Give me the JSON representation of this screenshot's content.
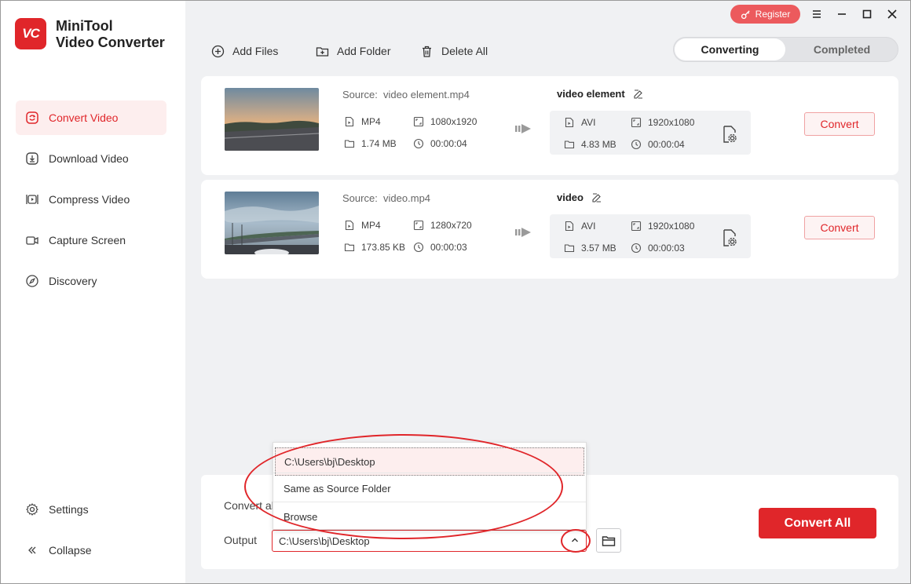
{
  "app": {
    "logo_text": "VC",
    "name_line1": "MiniTool",
    "name_line2": "Video Converter"
  },
  "sidebar": {
    "items": [
      {
        "label": "Convert Video",
        "icon": "convert-icon",
        "active": true
      },
      {
        "label": "Download Video",
        "icon": "download-icon"
      },
      {
        "label": "Compress Video",
        "icon": "compress-icon"
      },
      {
        "label": "Capture Screen",
        "icon": "camera-icon"
      },
      {
        "label": "Discovery",
        "icon": "compass-icon"
      }
    ],
    "settings_label": "Settings",
    "collapse_label": "Collapse"
  },
  "topbar": {
    "register_label": "Register"
  },
  "toolbar": {
    "add_files": "Add Files",
    "add_folder": "Add Folder",
    "delete_all": "Delete All",
    "tab_converting": "Converting",
    "tab_completed": "Completed"
  },
  "files": [
    {
      "source_prefix": "Source:",
      "source_name": "video element.mp4",
      "src_format": "MP4",
      "src_resolution": "1080x1920",
      "src_size": "1.74 MB",
      "src_duration": "00:00:04",
      "target_name": "video element",
      "tgt_format": "AVI",
      "tgt_resolution": "1920x1080",
      "tgt_size": "4.83 MB",
      "tgt_duration": "00:00:04",
      "convert_label": "Convert"
    },
    {
      "source_prefix": "Source:",
      "source_name": "video.mp4",
      "src_format": "MP4",
      "src_resolution": "1280x720",
      "src_size": "173.85 KB",
      "src_duration": "00:00:03",
      "target_name": "video",
      "tgt_format": "AVI",
      "tgt_resolution": "1920x1080",
      "tgt_size": "3.57 MB",
      "tgt_duration": "00:00:03",
      "convert_label": "Convert"
    }
  ],
  "bottom": {
    "convert_all_to_label": "Convert al",
    "output_label": "Output",
    "output_value": "C:\\Users\\bj\\Desktop",
    "convert_all_label": "Convert All"
  },
  "dropdown": {
    "options": [
      "C:\\Users\\bj\\Desktop",
      "Same as Source Folder",
      "Browse"
    ]
  },
  "colors": {
    "accent": "#e0262a",
    "register": "#ec5a5d",
    "active_bg": "#fdeeee"
  }
}
